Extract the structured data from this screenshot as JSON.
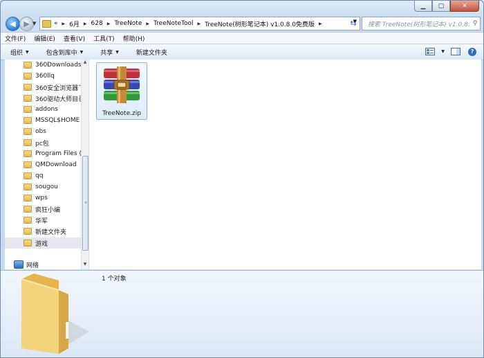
{
  "window": {
    "controls": {
      "minimize": "▁",
      "maximize": "▢",
      "close": "✕"
    }
  },
  "navigation": {
    "back_icon": "back-arrow-icon",
    "forward_icon": "forward-arrow-icon",
    "overflow": "«",
    "breadcrumbs": [
      "6月",
      "628",
      "TreeNote",
      "TreeNoteTool",
      "TreeNote(树形笔记本) v1.0.8.0免费版"
    ],
    "search_placeholder": "搜索 TreeNote(树形笔记本) v1.0.8.0..."
  },
  "menubar": {
    "items": [
      "文件(F)",
      "编辑(E)",
      "查看(V)",
      "工具(T)",
      "帮助(H)"
    ]
  },
  "commandbar": {
    "organize": "组织",
    "include_in_library": "包含到库中",
    "share": "共享",
    "new_folder": "新建文件夹",
    "dropdown_glyph": "▼",
    "help_glyph": "?"
  },
  "navpane": {
    "folders": [
      "360Downloads",
      "360llq",
      "360安全浏览器下",
      "360驱动大师目录",
      "addons",
      "MSSQL$HOME",
      "obs",
      "pc包",
      "Program Files (x",
      "QMDownload",
      "qq",
      "sougou",
      "wps",
      "疯狂小编",
      "华军",
      "新建文件夹",
      "游戏"
    ],
    "selected": "游戏",
    "network": "网络"
  },
  "content": {
    "files": [
      {
        "name": "TreeNote.zip",
        "icon": "winrar-archive-icon"
      }
    ]
  },
  "details": {
    "item_count": "1 个对象"
  },
  "colors": {
    "archive_red": "#c0303a",
    "archive_blue": "#3947b0",
    "archive_green": "#2f9a3c",
    "belt": "#c6893a",
    "folder_yellow": "#efcc66"
  }
}
